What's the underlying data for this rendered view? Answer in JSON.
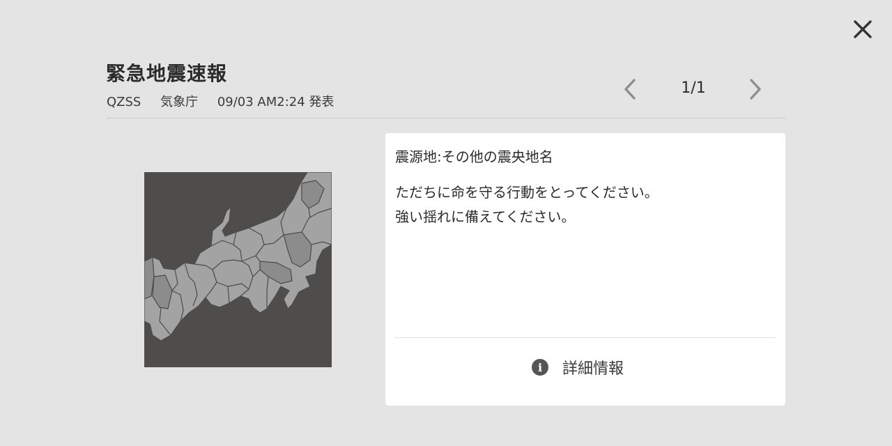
{
  "header": {
    "title": "緊急地震速報",
    "source": "QZSS",
    "agency": "気象庁",
    "issued": "09/03 AM2:24 発表"
  },
  "pager": {
    "indicator": "1/1",
    "prev_icon": "chevron-left-icon",
    "next_icon": "chevron-right-icon"
  },
  "close_icon": "close-icon",
  "map": {
    "icon": "japan-region-map",
    "colors": {
      "sea": "#4f4c4c",
      "land": "#a3a3a3",
      "land_dark": "#8c8c8c",
      "border": "#4a4a4a"
    }
  },
  "card": {
    "epicenter": "震源地:その他の震央地名",
    "messages": [
      "ただちに命を守る行動をとってください。",
      "強い揺れに備えてください。"
    ],
    "details_label": "詳細情報",
    "details_icon": "info-icon"
  },
  "colors": {
    "background": "#e3e4e3",
    "card": "#ffffff",
    "text": "#2b2b2b",
    "icon_gray": "#8e8e8e"
  }
}
